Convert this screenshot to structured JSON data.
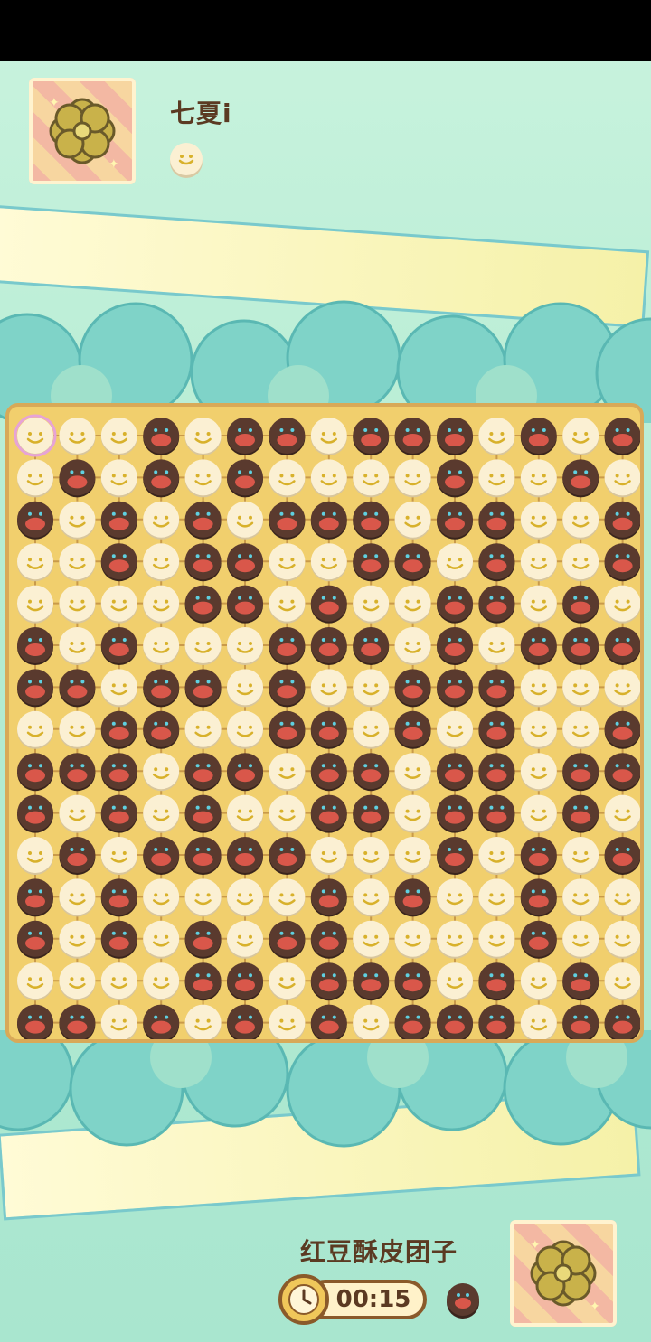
{
  "opponent": {
    "name": "七夏i",
    "stone": "light"
  },
  "player": {
    "name": "红豆酥皮团子",
    "stone": "dark",
    "timer": "00:15"
  },
  "colors": {
    "light_stone": "#fbf0d3",
    "dark_stone": "#5a3a2e",
    "board": "#f1cf6d",
    "selected_ring": "#e7a3d6"
  },
  "icons": {
    "avatar": "flower-badge-icon",
    "clock": "clock-icon"
  },
  "board": {
    "size": 15,
    "selected": [
      0,
      0
    ],
    "rows": [
      "LLLDLDDLDDDLDLD",
      "LDLDLDLLLLDLLDL",
      "DLDLDLDDDLDDLLD",
      "LLDLDDLLDDLDLLD",
      "LLLLDDLDLLDDLDL",
      "DLDLLLDDDLDLDDD",
      "DDLDDLDLLDDDLLL",
      "LLDDLLDDLDLDLLD",
      "DDDLDDLDDLDDLDD",
      "DLDLDLLDDLDDLDL",
      "LDLDDDDLLLDLDLD",
      "DLDLLLLDLDLLDLL",
      "DLDLDLDDLLLLDLL",
      "LLLLDDLDDDLDLDL",
      "DDLDLDLDLDDDLDD"
    ]
  }
}
